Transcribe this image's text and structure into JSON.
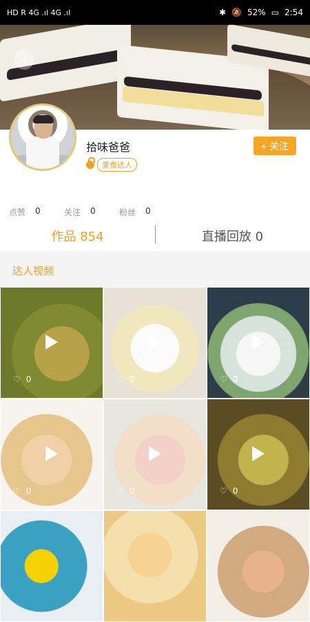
{
  "status_bar": {
    "left": "HD R 4G .ıl 4G .ıl",
    "battery_percent": "52%",
    "time": "2:54"
  },
  "header": {
    "back_icon": "chevron-left-icon"
  },
  "profile": {
    "name": "拾味爸爸",
    "badge": "美食达人",
    "follow_button": "+ 关注",
    "stats": [
      {
        "label": "点赞",
        "value": "0"
      },
      {
        "label": "关注",
        "value": "0"
      },
      {
        "label": "粉丝",
        "value": "0"
      }
    ]
  },
  "tabs": [
    {
      "label": "作品",
      "count": "854"
    },
    {
      "label": "直播回放",
      "count": "0"
    }
  ],
  "section": {
    "title": "达人视频"
  },
  "videos": [
    {
      "likes": "0"
    },
    {
      "likes": "0"
    },
    {
      "likes": "0"
    },
    {
      "likes": "0"
    },
    {
      "likes": "0"
    },
    {
      "likes": "0"
    },
    {
      "likes": ""
    },
    {
      "likes": ""
    },
    {
      "likes": ""
    }
  ],
  "colors": {
    "accent": "#f6a623",
    "accent_text": "#f0a020",
    "status_bar": "#000000",
    "section_bg": "#f4f4f4"
  }
}
